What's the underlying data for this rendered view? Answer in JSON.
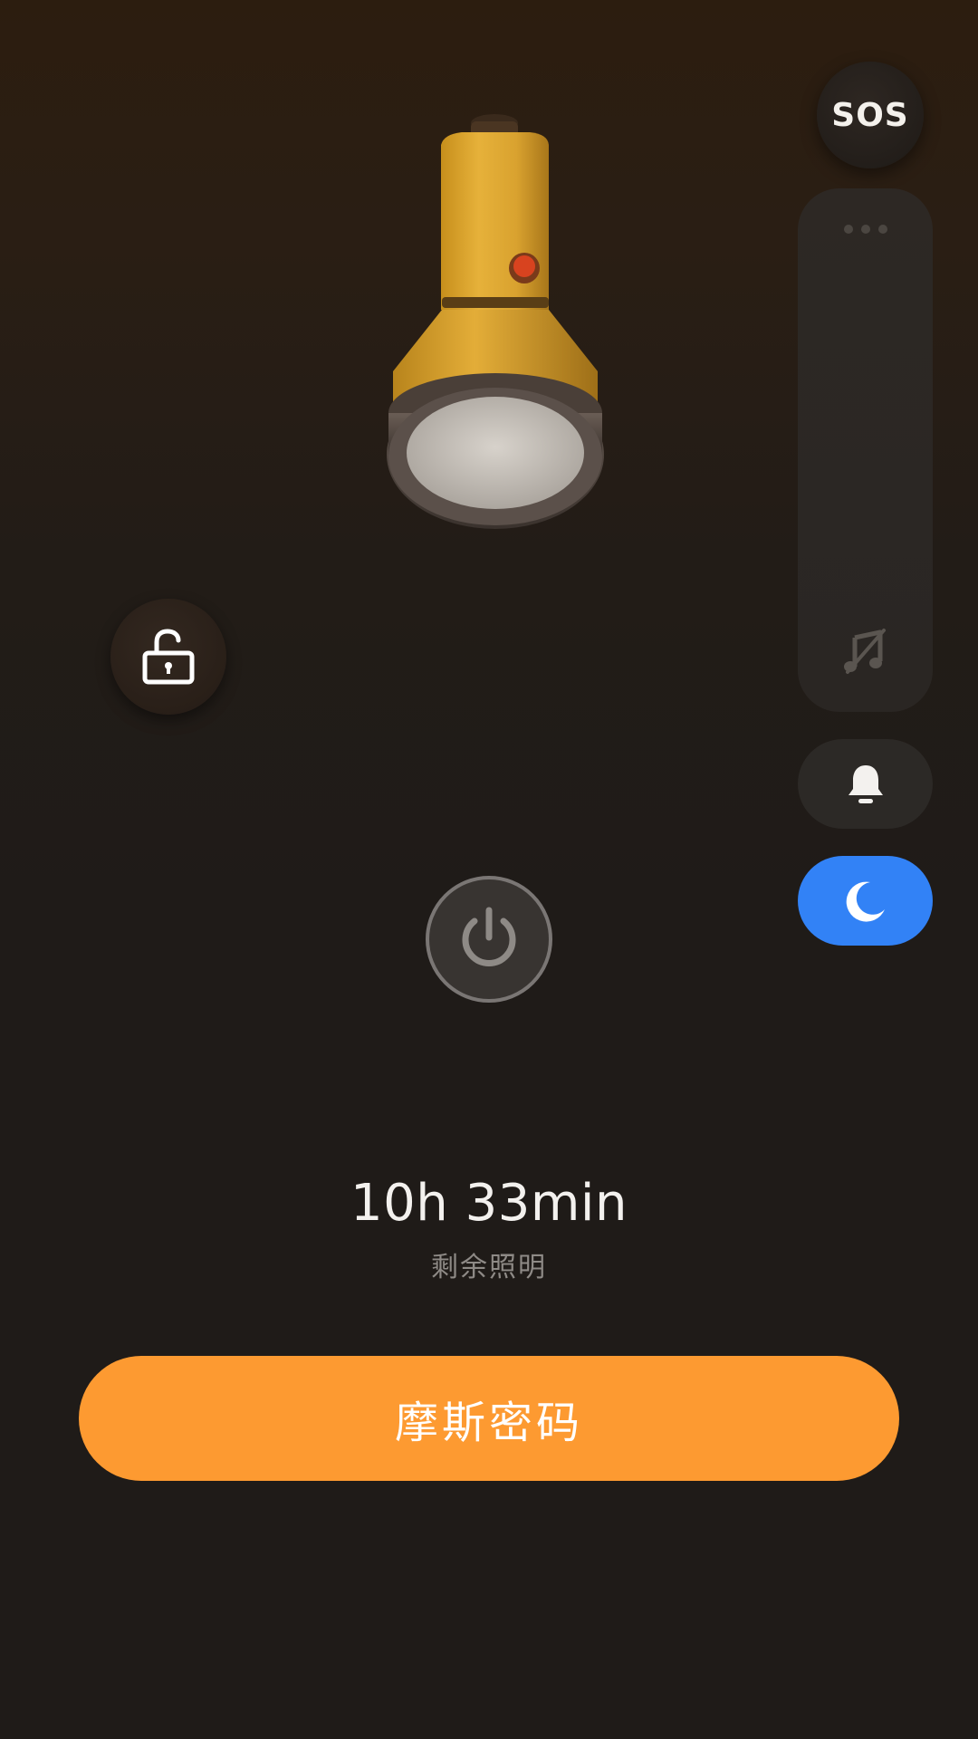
{
  "buttons": {
    "sos_label": "SOS",
    "morse_label": "摩斯密码"
  },
  "status": {
    "remaining_time": "10h 33min",
    "remaining_label": "剩余照明"
  },
  "icons": {
    "flashlight": "flashlight-illustration",
    "lock": "unlock-icon",
    "power": "power-icon",
    "slider_handle": "more-dots-icon",
    "music": "music-off-icon",
    "bell": "bell-icon",
    "moon": "moon-icon"
  },
  "colors": {
    "accent_orange": "#fd9a31",
    "moon_active_blue": "#3282f6",
    "background": "#1f1b18",
    "flashlight_body": "#e8b23a"
  }
}
